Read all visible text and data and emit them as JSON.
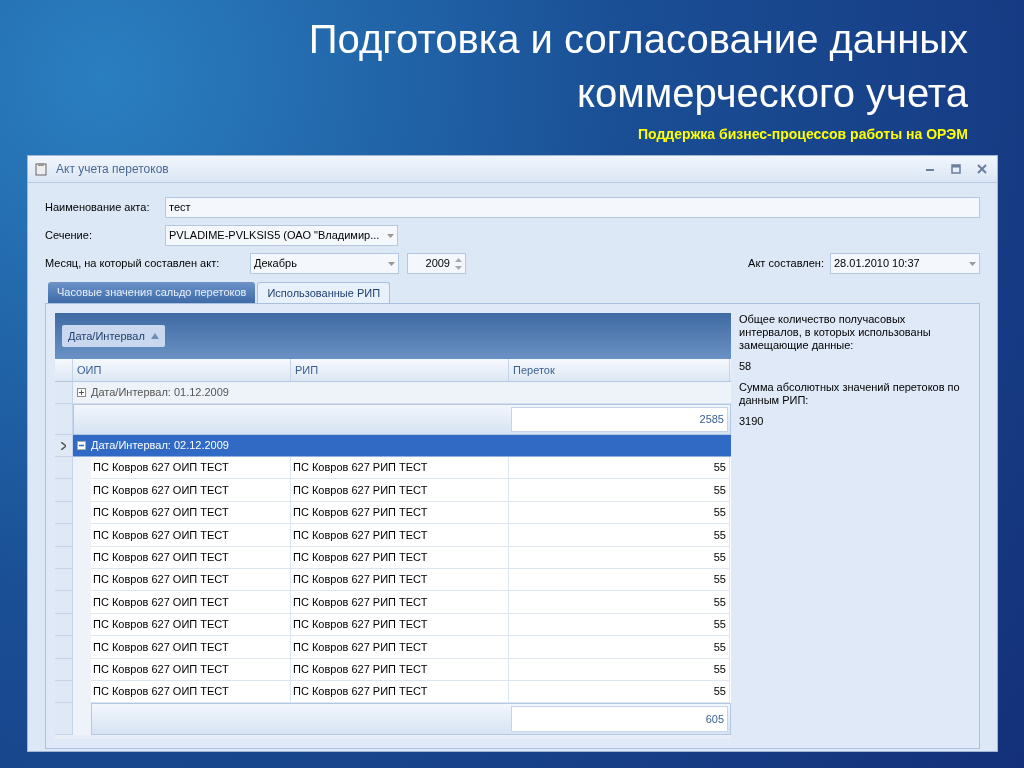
{
  "slide": {
    "title_lines": [
      "Подготовка и согласование данных",
      "коммерческого учета"
    ],
    "subtitle": "Поддержка бизнес-процессов работы на ОРЭМ"
  },
  "window": {
    "title": "Акт учета перетоков"
  },
  "form": {
    "name_label": "Наименование акта:",
    "name_value": "тест",
    "section_label": "Сечение:",
    "section_value": "PVLADIME-PVLKSIS5 (ОАО \"Владимир...",
    "month_label": "Месяц, на который составлен акт:",
    "month_value": "Декабрь",
    "year_value": "2009",
    "date_label": "Акт составлен:",
    "date_value": "28.01.2010 10:37"
  },
  "tabs": [
    {
      "label": "Часовые значения сальдо перетоков",
      "selected": false
    },
    {
      "label": "Использованные РИП",
      "selected": true
    }
  ],
  "grid": {
    "group_by": "Дата/Интервал",
    "columns": [
      "ОИП",
      "РИП",
      "Переток"
    ],
    "groups": [
      {
        "label": "Дата/Интервал: 01.12.2009",
        "expanded": false,
        "selected": false,
        "total": "2585"
      },
      {
        "label": "Дата/Интервал: 02.12.2009",
        "expanded": true,
        "selected": true,
        "total": "605",
        "rows": [
          [
            "ПС Ковров 627 ОИП ТЕСТ",
            "ПС Ковров 627 РИП ТЕСТ",
            "55"
          ],
          [
            "ПС Ковров 627 ОИП ТЕСТ",
            "ПС Ковров 627 РИП ТЕСТ",
            "55"
          ],
          [
            "ПС Ковров 627 ОИП ТЕСТ",
            "ПС Ковров 627 РИП ТЕСТ",
            "55"
          ],
          [
            "ПС Ковров 627 ОИП ТЕСТ",
            "ПС Ковров 627 РИП ТЕСТ",
            "55"
          ],
          [
            "ПС Ковров 627 ОИП ТЕСТ",
            "ПС Ковров 627 РИП ТЕСТ",
            "55"
          ],
          [
            "ПС Ковров 627 ОИП ТЕСТ",
            "ПС Ковров 627 РИП ТЕСТ",
            "55"
          ],
          [
            "ПС Ковров 627 ОИП ТЕСТ",
            "ПС Ковров 627 РИП ТЕСТ",
            "55"
          ],
          [
            "ПС Ковров 627 ОИП ТЕСТ",
            "ПС Ковров 627 РИП ТЕСТ",
            "55"
          ],
          [
            "ПС Ковров 627 ОИП ТЕСТ",
            "ПС Ковров 627 РИП ТЕСТ",
            "55"
          ],
          [
            "ПС Ковров 627 ОИП ТЕСТ",
            "ПС Ковров 627 РИП ТЕСТ",
            "55"
          ],
          [
            "ПС Ковров 627 ОИП ТЕСТ",
            "ПС Ковров 627 РИП ТЕСТ",
            "55"
          ]
        ]
      }
    ]
  },
  "summary": [
    {
      "label": "Общее количество получасовых интервалов, в которых использованы замещающие данные:",
      "value": "58"
    },
    {
      "label": "Сумма абсолютных значений перетоков по данным РИП:",
      "value": "3190"
    }
  ]
}
